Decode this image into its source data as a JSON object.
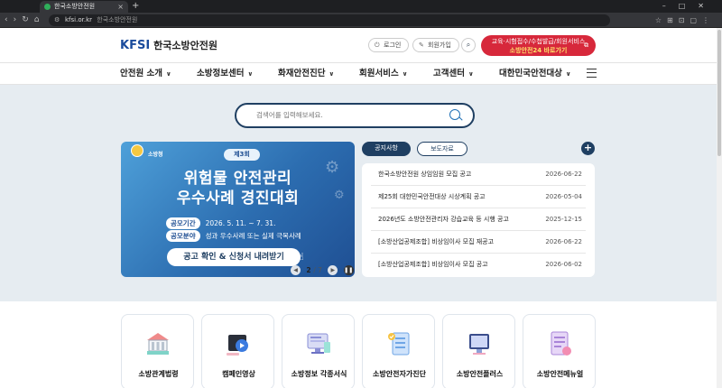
{
  "browser": {
    "tab_title": "한국소방안전원",
    "tab_close": "×",
    "new_tab": "+",
    "url_domain": "kfsi.or.kr",
    "url_title": "한국소방안전원"
  },
  "header": {
    "logo_en": "KFSI",
    "logo_kr": "한국소방안전원",
    "login_label": "로그인",
    "signup_label": "회원가입",
    "cta_line1": "교육·시험접수/수첩발급/회원서비스",
    "cta_line2": "소방안전24 바로가기",
    "cta_color": "#d7283b"
  },
  "gnb": {
    "items": [
      {
        "label": "안전원 소개"
      },
      {
        "label": "소방정보센터"
      },
      {
        "label": "화재안전진단"
      },
      {
        "label": "회원서비스"
      },
      {
        "label": "고객센터"
      },
      {
        "label": "대한민국안전대상"
      }
    ]
  },
  "search": {
    "placeholder": "검색어를 입력해보세요."
  },
  "banner": {
    "agency": "소방청",
    "edition": "제3회",
    "title_line1": "위험물 안전관리",
    "title_line2": "우수사례 경진대회",
    "period_label": "공모기간",
    "period_value": "2026. 5. 11. ~ 7. 31.",
    "field_label": "공모분야",
    "field_value": "성과 우수사례 또는 실제 극복사례",
    "cta": "공고 확인 & 신청서 내려받기",
    "current_page": "2",
    "total_pages": "/ 7"
  },
  "notices": {
    "tab_active": "공지사항",
    "tab_inactive": "보도자료",
    "more": "+",
    "items": [
      {
        "title": "한국소방안전원 상임임원 모집 공고",
        "date": "2026-06-22"
      },
      {
        "title": "제25회 대한민국안전대상 시상계획 공고",
        "date": "2026-05-04"
      },
      {
        "title": "2026년도 소방안전관리자 강습교육 등 시행 공고",
        "date": "2025-12-15"
      },
      {
        "title": "[소방산업공제조합] 비상임이사 모집 재공고",
        "date": "2026-06-22"
      },
      {
        "title": "[소방산업공제조합] 비상임이사 모집 공고",
        "date": "2026-06-02"
      }
    ]
  },
  "quicklinks": [
    {
      "label": "소방관계법령",
      "icon": "building-icon"
    },
    {
      "label": "캠페인영상",
      "icon": "video-icon"
    },
    {
      "label": "소방정보 각종서식",
      "icon": "monitor-form-icon"
    },
    {
      "label": "소방안전자가진단",
      "icon": "checklist-icon"
    },
    {
      "label": "소방안전플러스",
      "icon": "monitor-icon"
    },
    {
      "label": "소방안전메뉴얼",
      "icon": "manual-icon"
    }
  ]
}
